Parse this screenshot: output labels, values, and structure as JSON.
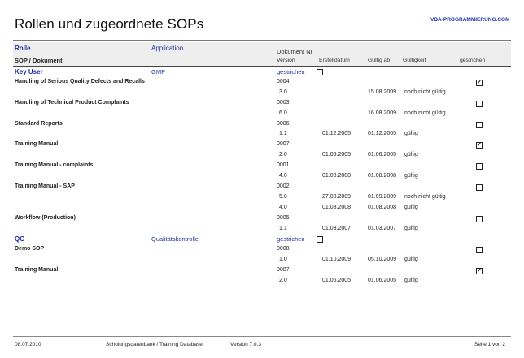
{
  "report": {
    "title": "Rollen und zugeordnete SOPs",
    "brand": "VBA-PROGRAMMIERUNG.COM"
  },
  "header": {
    "rolle": "Rolle",
    "application": "Application",
    "dokument_nr": "Dokument Nr",
    "sop_dokument": "SOP / Dokument",
    "version": "Version",
    "erstelldatum": "Erstelldatum",
    "gueltig_ab": "Gültig ab",
    "gueltigkeit": "Gültigkeit",
    "gestrichen": "gestrichen"
  },
  "groups": [
    {
      "role": "Key User",
      "application": "GMP",
      "gestrichen_label": "gestrichen",
      "gestrichen_checked": false,
      "documents": [
        {
          "name": "Handling of Serious Quality Defects and Recalls",
          "number": "0004",
          "gestrichen": true,
          "versions": [
            {
              "version": "3.0",
              "erstelldatum": "",
              "gueltig_ab": "15.08.2009",
              "gueltigkeit": "noch nicht gültig"
            }
          ]
        },
        {
          "name": "Handling of Technical Product Complaints",
          "number": "0003",
          "gestrichen": false,
          "versions": [
            {
              "version": "6.0",
              "erstelldatum": "",
              "gueltig_ab": "16.08.2009",
              "gueltigkeit": "noch nicht gültig"
            }
          ]
        },
        {
          "name": "Standard Reports",
          "number": "0006",
          "gestrichen": false,
          "versions": [
            {
              "version": "1.1",
              "erstelldatum": "01.12.2005",
              "gueltig_ab": "01.12.2005",
              "gueltigkeit": "gültig"
            }
          ]
        },
        {
          "name": "Training Manual",
          "number": "0007",
          "gestrichen": true,
          "versions": [
            {
              "version": "2.0",
              "erstelldatum": "01.06.2005",
              "gueltig_ab": "01.06.2005",
              "gueltigkeit": "gültig"
            }
          ]
        },
        {
          "name": "Training Manual - complaints",
          "number": "0001",
          "gestrichen": false,
          "versions": [
            {
              "version": "4.0",
              "erstelldatum": "01.08.2008",
              "gueltig_ab": "01.08.2008",
              "gueltigkeit": "gültig"
            }
          ]
        },
        {
          "name": "Training Manual - SAP",
          "number": "0002",
          "gestrichen": false,
          "versions": [
            {
              "version": "5.0",
              "erstelldatum": "27.08.2009",
              "gueltig_ab": "01.09.2009",
              "gueltigkeit": "noch nicht gültig"
            },
            {
              "version": "4.0",
              "erstelldatum": "01.08.2008",
              "gueltig_ab": "01.08.2008",
              "gueltigkeit": "gültig"
            }
          ]
        },
        {
          "name": "Workflow (Production)",
          "number": "0005",
          "gestrichen": false,
          "versions": [
            {
              "version": "1.1",
              "erstelldatum": "01.03.2007",
              "gueltig_ab": "01.03.2007",
              "gueltigkeit": "gültig"
            }
          ]
        }
      ]
    },
    {
      "role": "QC",
      "application": "Qualitätskontrolle",
      "gestrichen_label": "gestrichen",
      "gestrichen_checked": false,
      "documents": [
        {
          "name": "Demo SOP",
          "number": "0008",
          "gestrichen": false,
          "versions": [
            {
              "version": "1.0",
              "erstelldatum": "01.10.2009",
              "gueltig_ab": "05.10.2009",
              "gueltigkeit": "gültig"
            }
          ]
        },
        {
          "name": "Training Manual",
          "number": "0007",
          "gestrichen": true,
          "versions": [
            {
              "version": "2.0",
              "erstelldatum": "01.06.2005",
              "gueltig_ab": "01.06.2005",
              "gueltigkeit": "gültig"
            }
          ]
        }
      ]
    }
  ],
  "footer": {
    "date": "08.07.2010",
    "database": "Schulungsdatenbank / Training Database",
    "version": "Version 7.0.3",
    "page": "Seite 1 von 2"
  },
  "colors": {
    "accent": "#1f2f99",
    "band": "#eeeeee"
  }
}
